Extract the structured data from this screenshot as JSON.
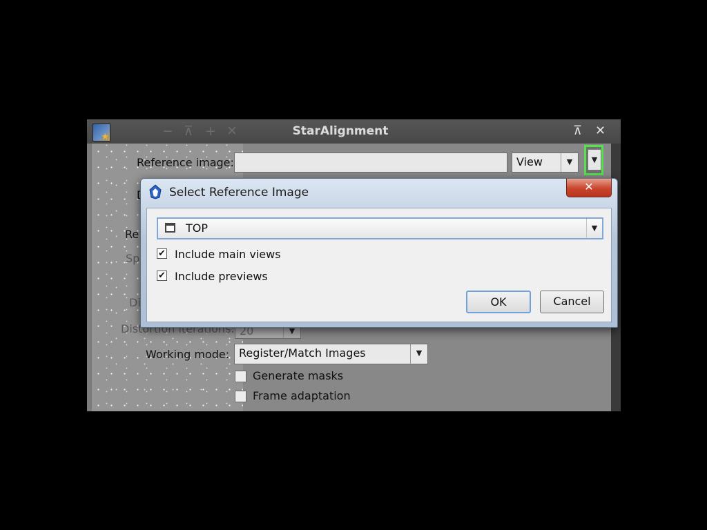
{
  "window": {
    "title": "StarAlignment",
    "left_controls": [
      "−",
      "⊼",
      "+",
      "✕"
    ],
    "right_controls": [
      "⊼",
      "✕"
    ]
  },
  "form": {
    "reference_image_label": "Reference image:",
    "reference_image_value": "",
    "reference_mode": "View",
    "distortion_iterations_label": "Distortion iterations:",
    "distortion_iterations_value": "20",
    "working_mode_label": "Working mode:",
    "working_mode_value": "Register/Match Images",
    "generate_masks_label": "Generate masks",
    "frame_adaptation_label": "Frame adaptation",
    "partial_labels": {
      "d1": "D",
      "re": "Re",
      "sp": "Sp",
      "di": "Di"
    }
  },
  "dialog": {
    "title": "Select Reference Image",
    "selected_image": "TOP",
    "include_main_views_label": "Include main views",
    "include_main_views_checked": true,
    "include_previews_label": "Include previews",
    "include_previews_checked": true,
    "ok_label": "OK",
    "cancel_label": "Cancel",
    "close_glyph": "✕",
    "check_glyph": "✔"
  },
  "colors": {
    "highlight": "#56e14e",
    "dialog_frame": "#b7c7db",
    "close_button": "#c8442c"
  }
}
